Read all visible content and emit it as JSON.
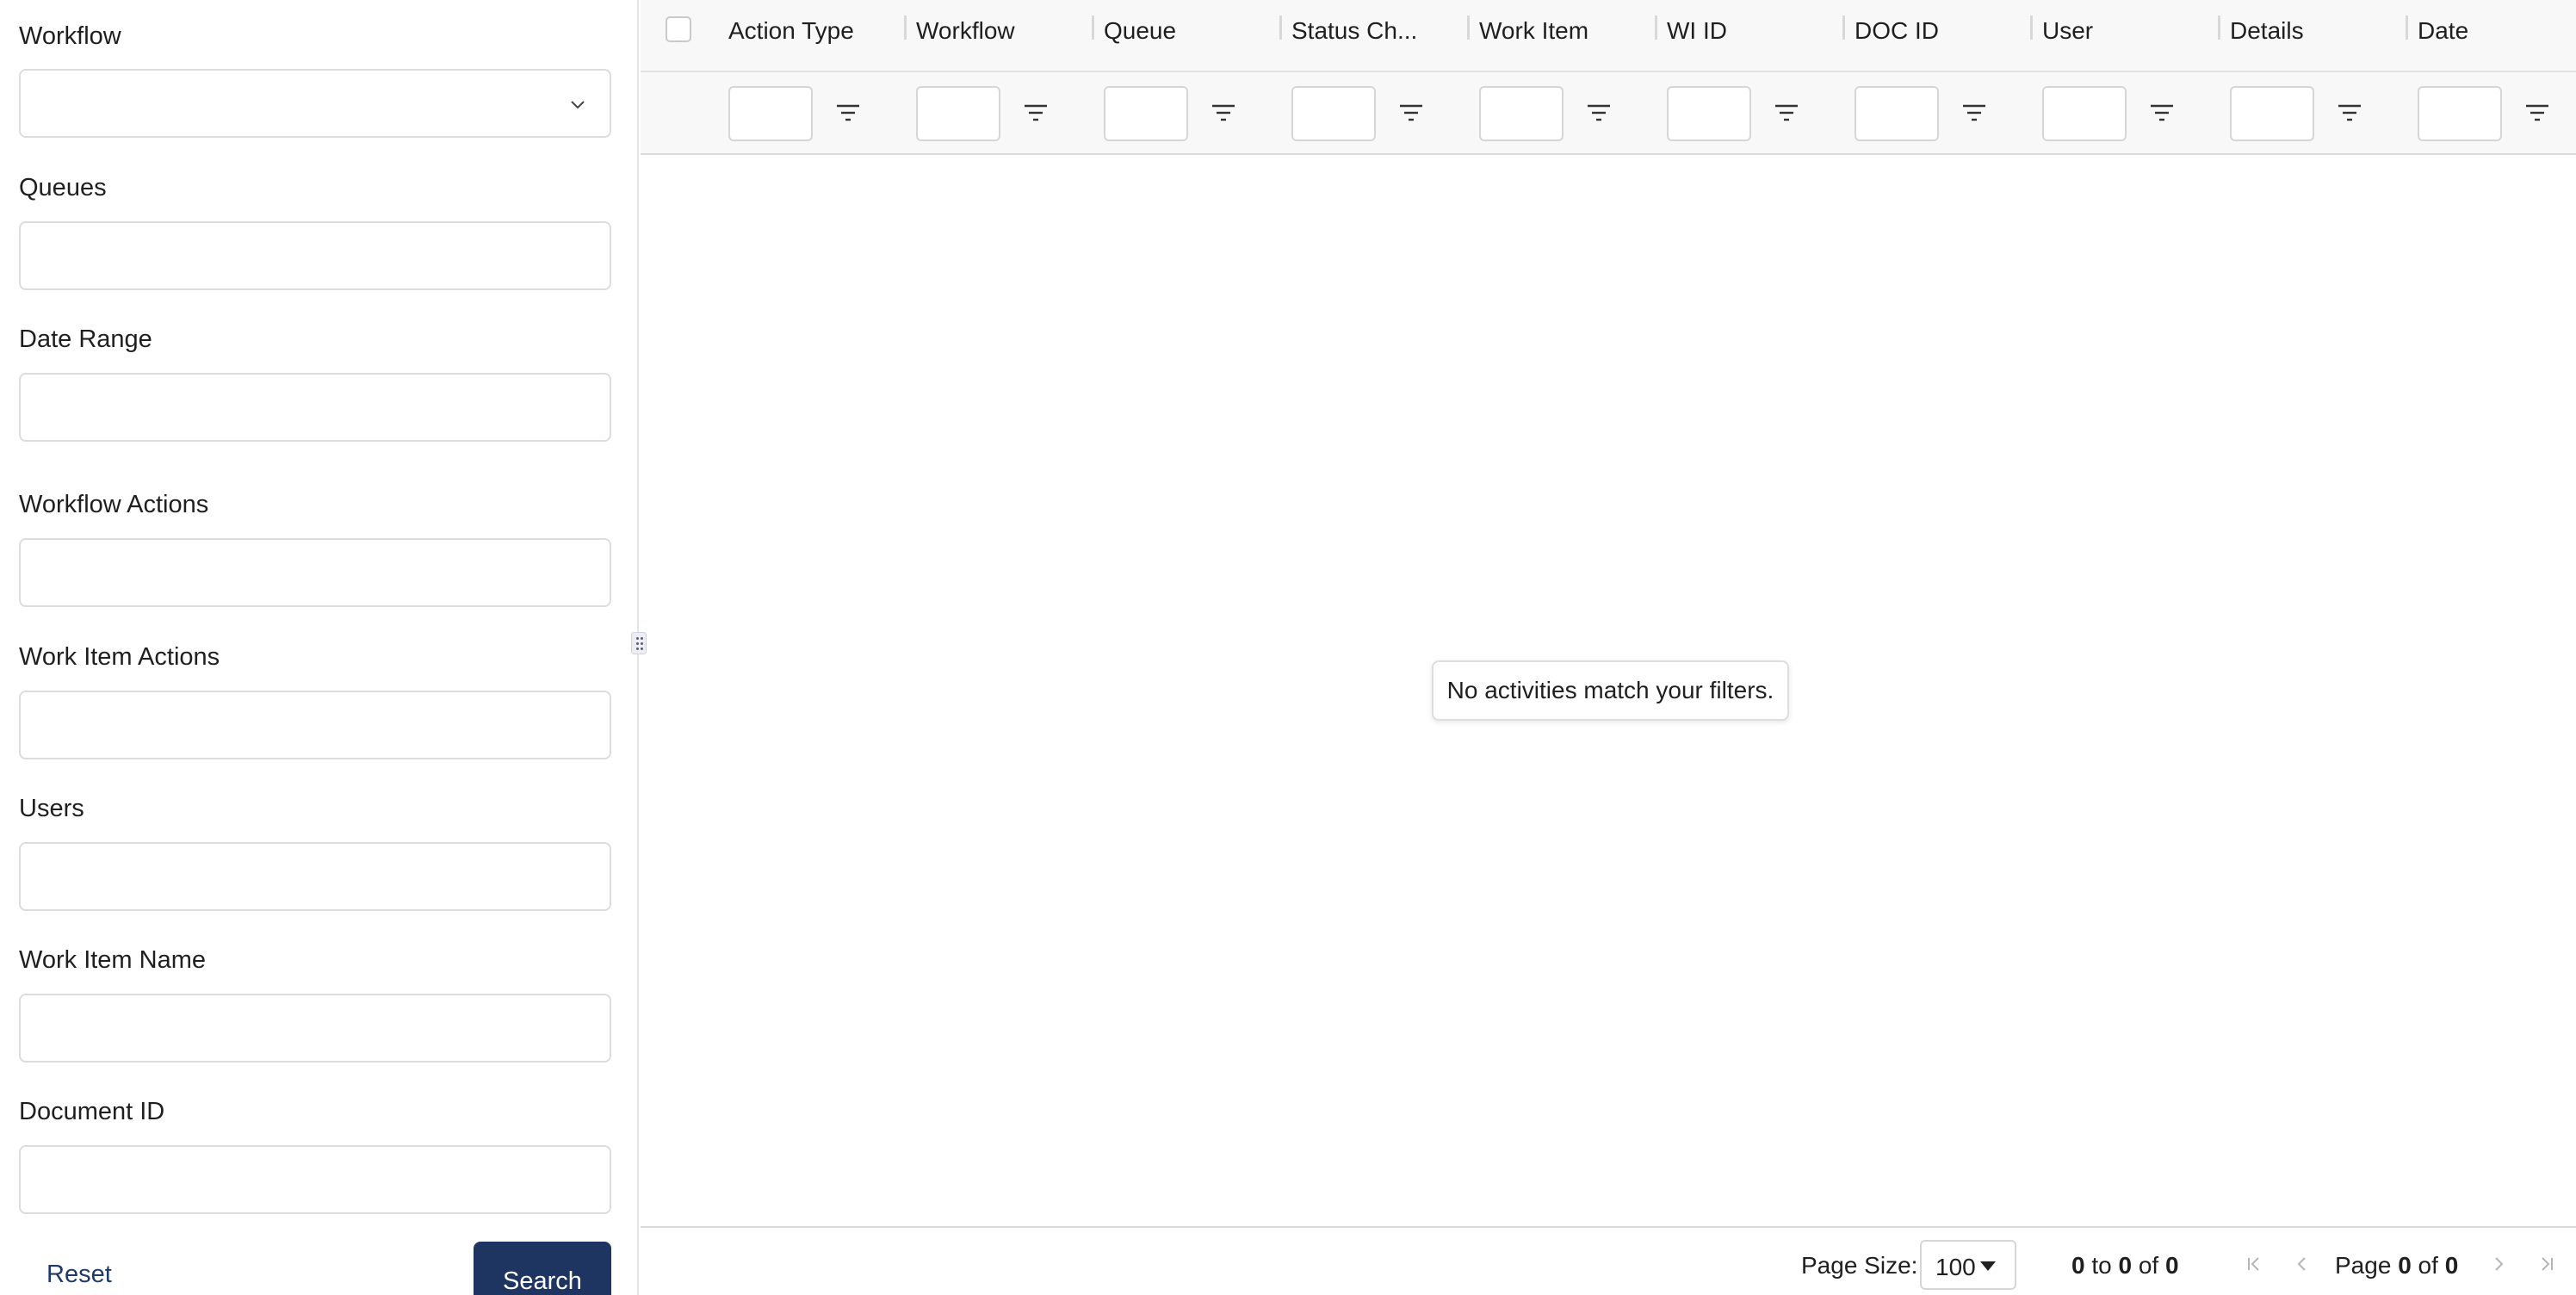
{
  "filters": {
    "workflow_label": "Workflow",
    "workflow_value": "",
    "queues_label": "Queues",
    "date_range_label": "Date Range",
    "workflow_actions_label": "Workflow Actions",
    "work_item_actions_label": "Work Item Actions",
    "users_label": "Users",
    "work_item_name_label": "Work Item Name",
    "document_id_label": "Document ID",
    "reset_label": "Reset",
    "search_label": "Search"
  },
  "grid": {
    "columns": [
      {
        "title": "Action Type"
      },
      {
        "title": "Workflow"
      },
      {
        "title": "Queue"
      },
      {
        "title": "Status Ch..."
      },
      {
        "title": "Work Item"
      },
      {
        "title": "WI ID"
      },
      {
        "title": "DOC ID"
      },
      {
        "title": "User"
      },
      {
        "title": "Details"
      },
      {
        "title": "Date"
      }
    ],
    "empty_message": "No activities match your filters."
  },
  "pager": {
    "page_size_label": "Page Size:",
    "page_size_value": "100",
    "range_from": "0",
    "range_to_word": "to",
    "range_to": "0",
    "range_of_word": "of",
    "range_total": "0",
    "page_word": "Page",
    "page_current": "0",
    "page_of_word": "of",
    "page_total": "0"
  },
  "icons": {
    "filter": "filter-lines-icon",
    "dropdown": "chevron-down-icon",
    "first": "first-page-icon",
    "prev": "previous-page-icon",
    "next": "next-page-icon",
    "last": "last-page-icon",
    "splitter": "splitter-grip-icon"
  },
  "colors": {
    "primary": "#1e3461",
    "link": "#1f3a68"
  }
}
